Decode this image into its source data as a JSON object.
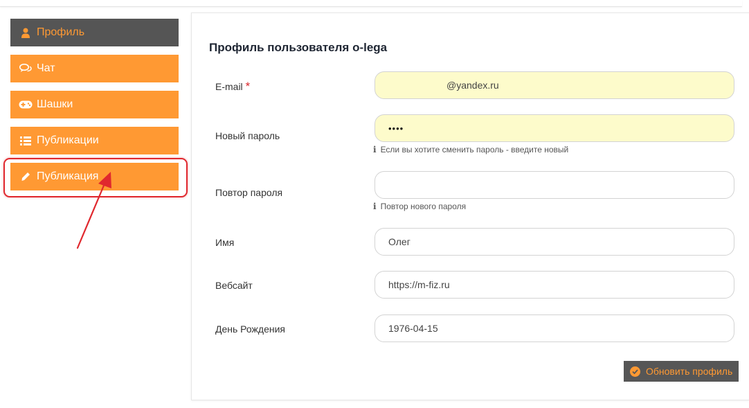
{
  "sidebar": {
    "items": [
      {
        "label": "Профиль",
        "icon": "user-icon",
        "active": true
      },
      {
        "label": "Чат",
        "icon": "chat-icon"
      },
      {
        "label": "Шашки",
        "icon": "gamepad-icon"
      },
      {
        "label": "Публикации",
        "icon": "list-icon"
      },
      {
        "label": "Публикация",
        "icon": "pencil-icon"
      }
    ]
  },
  "form": {
    "title": "Профиль пользователя o-lega",
    "email": {
      "label": "E-mail",
      "required_mark": "*",
      "value": "@yandex.ru"
    },
    "new_password": {
      "label": "Новый пароль",
      "value": "••••",
      "hint": "Если вы хотите сменить пароль - введите новый"
    },
    "repeat_password": {
      "label": "Повтор пароля",
      "value": "",
      "hint": "Повтор нового пароля"
    },
    "name": {
      "label": "Имя",
      "value": "Олег"
    },
    "website": {
      "label": "Вебсайт",
      "value": "https://m-fiz.ru"
    },
    "birthday": {
      "label": "День Рождения",
      "value": "1976-04-15"
    },
    "submit_label": "Обновить профиль"
  },
  "colors": {
    "accent": "#ff9933",
    "active_bg": "#555555",
    "autofill_bg": "#fdfbcb",
    "annotation": "#e0282e"
  }
}
